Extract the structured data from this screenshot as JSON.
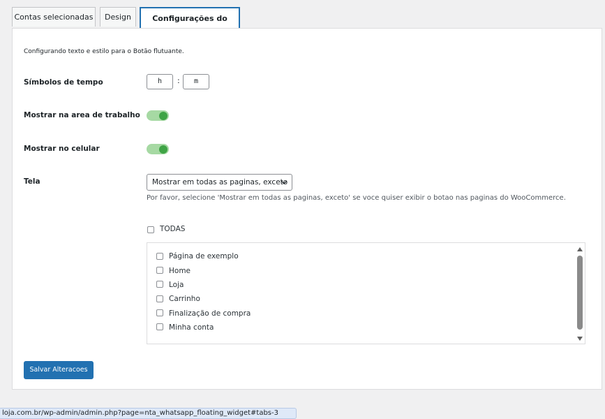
{
  "tabs": [
    {
      "label": "Contas selecionadas"
    },
    {
      "label": "Design"
    },
    {
      "label": "Configurações do Botão"
    }
  ],
  "intro": "Configurando texto e estilo para o Botão flutuante.",
  "time_symbols": {
    "label": "Símbolos de tempo",
    "hour": "h",
    "separator": ":",
    "minute": "m"
  },
  "desktop_toggle": {
    "label": "Mostrar na area de trabalho",
    "on": true
  },
  "mobile_toggle": {
    "label": "Mostrar no celular",
    "on": true
  },
  "screen": {
    "label": "Tela",
    "selected": "Mostrar em todas as paginas, exceto",
    "hint": "Por favor, selecione 'Mostrar em todas as paginas, exceto' se voce quiser exibir o botao nas paginas do WooCommerce."
  },
  "all_pages": {
    "label": "TODAS",
    "checked": false
  },
  "pages": [
    {
      "label": "Página de exemplo"
    },
    {
      "label": "Home"
    },
    {
      "label": "Loja"
    },
    {
      "label": "Carrinho"
    },
    {
      "label": "Finalização de compra"
    },
    {
      "label": "Minha conta"
    }
  ],
  "save_label": "Salvar Alteracoes",
  "status_url": "loja.com.br/wp-admin/admin.php?page=nta_whatsapp_floating_widget#tabs-3",
  "colors": {
    "accent": "#2271b1",
    "toggle_on": "#3fa446"
  }
}
